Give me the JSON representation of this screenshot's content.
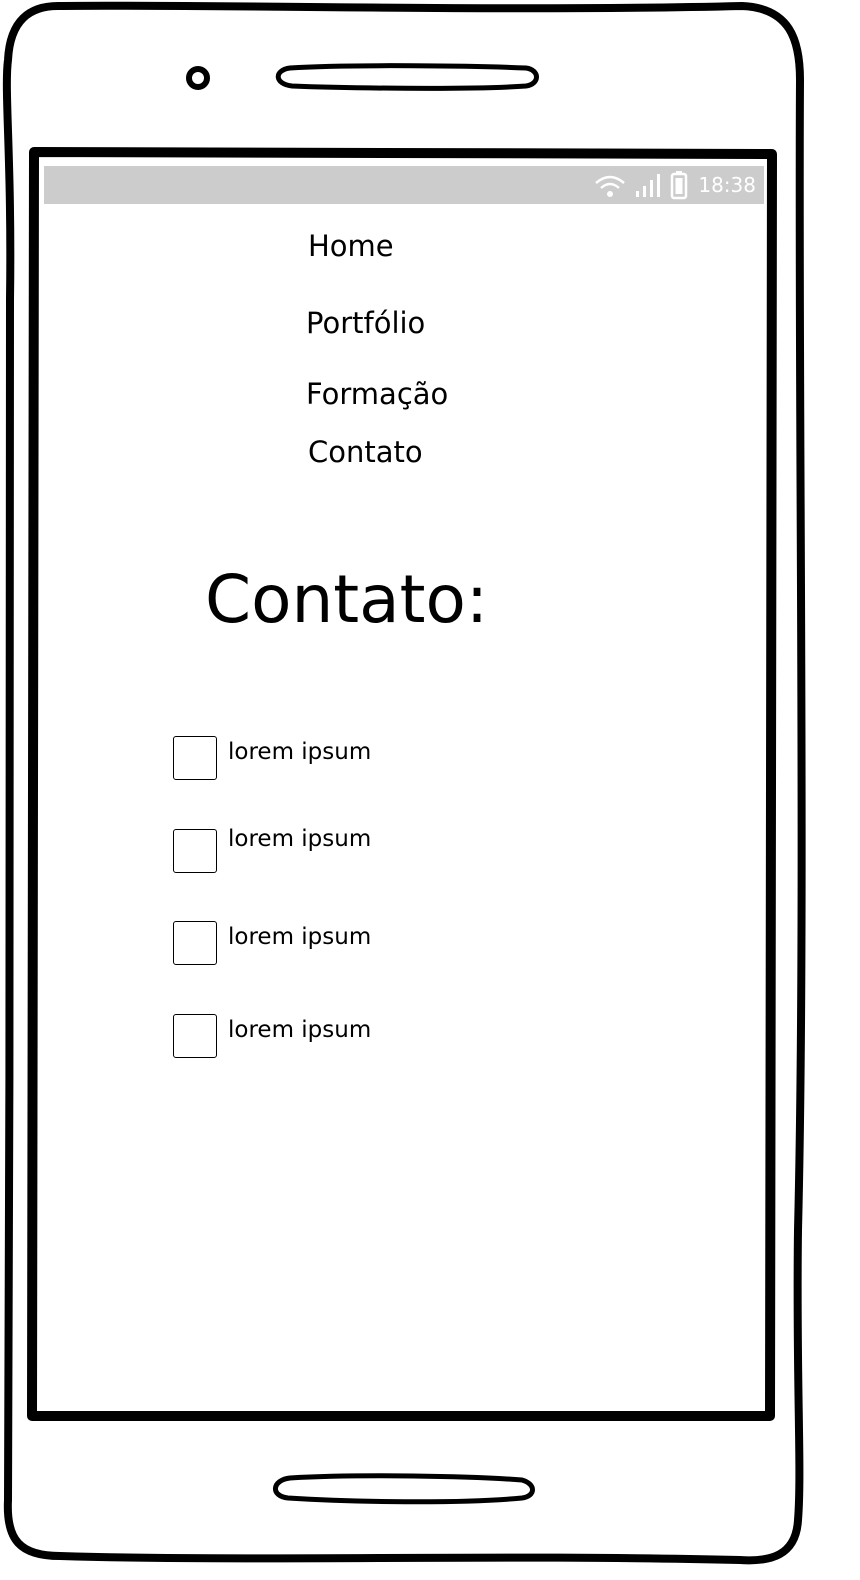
{
  "status_bar": {
    "time": "18:38",
    "icons": [
      "wifi-icon",
      "signal-icon",
      "battery-icon"
    ],
    "background": "#cccccc"
  },
  "nav": {
    "items": [
      {
        "label": "Home"
      },
      {
        "label": "Portfólio"
      },
      {
        "label": "Formação"
      },
      {
        "label": "Contato"
      }
    ]
  },
  "main": {
    "title": "Contato:",
    "options": [
      {
        "label": "lorem ipsum",
        "checked": false
      },
      {
        "label": "lorem ipsum",
        "checked": false
      },
      {
        "label": "lorem ipsum",
        "checked": false
      },
      {
        "label": "lorem ipsum",
        "checked": false
      }
    ]
  },
  "device": {
    "icons": [
      "camera-icon",
      "speaker-icon",
      "home-button-icon"
    ]
  }
}
